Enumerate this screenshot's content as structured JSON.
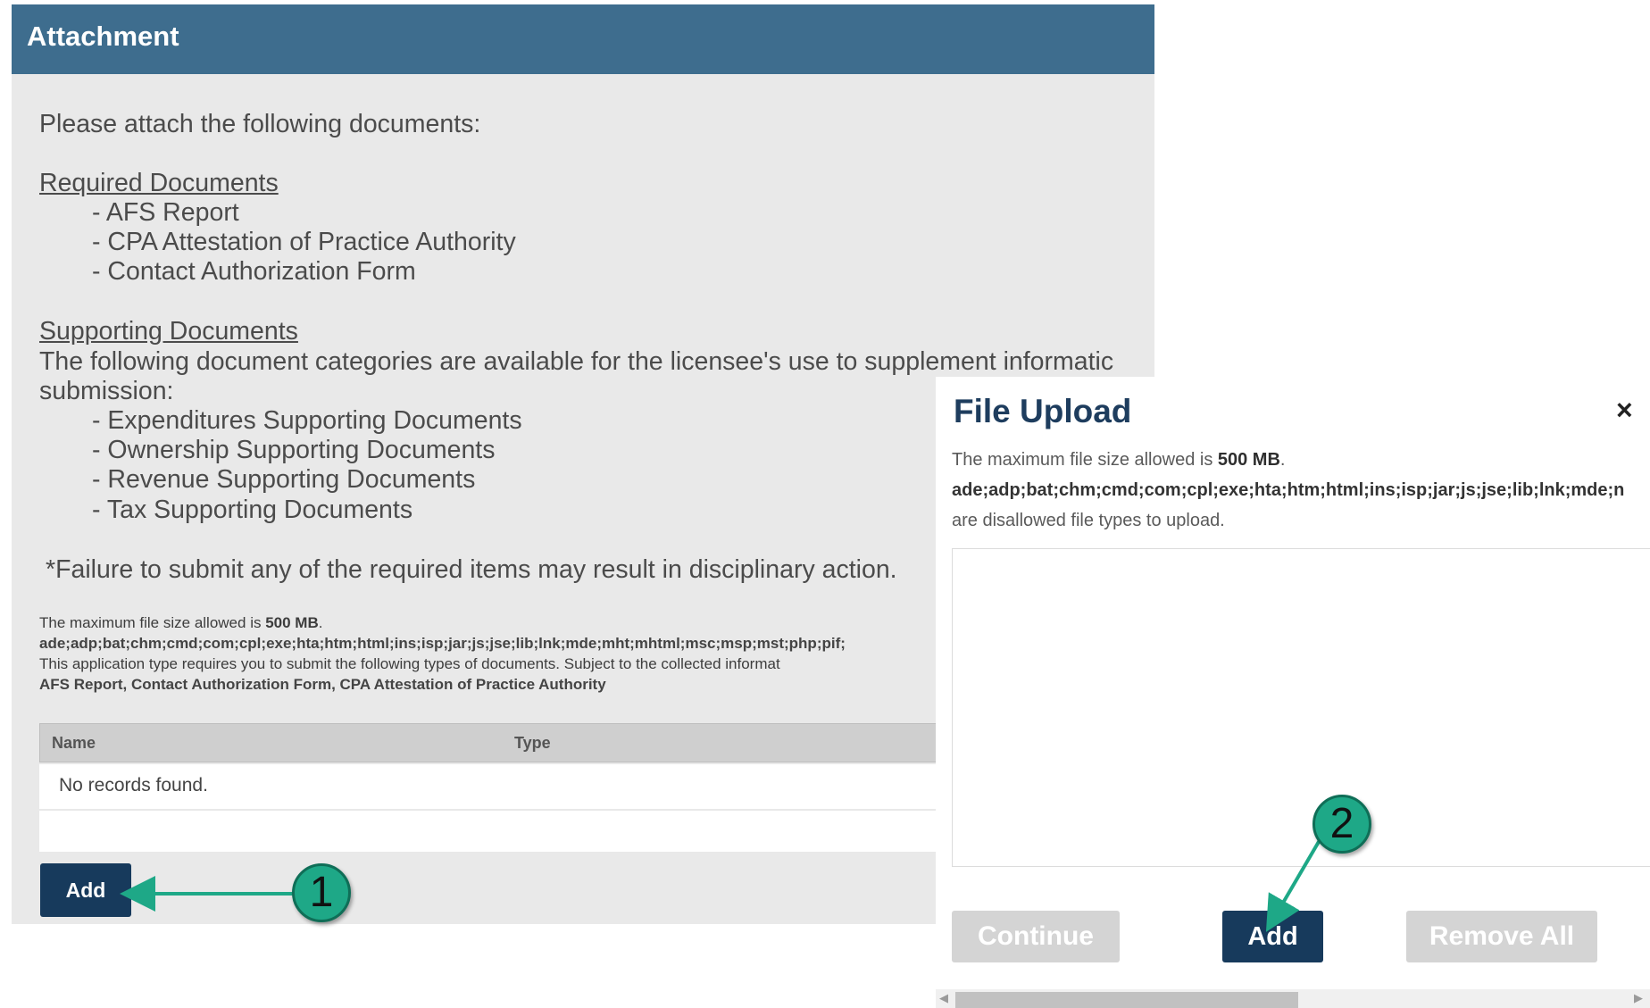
{
  "attachment": {
    "title": "Attachment",
    "intro": "Please attach the following documents:",
    "required_title": "Required Documents",
    "required_items": [
      "- AFS Report",
      "- CPA Attestation of Practice Authority",
      "- Contact Authorization Form"
    ],
    "supporting_title": "Supporting Documents",
    "supporting_desc_line1": "The following document categories are available for the licensee's use to supplement informatic",
    "supporting_desc_line2": "submission:",
    "supporting_items": [
      "- Expenditures Supporting Documents",
      "- Ownership Supporting Documents",
      "- Revenue Supporting Documents",
      "- Tax Supporting Documents"
    ],
    "warning": "*Failure to submit any of the required items may result in disciplinary action.",
    "max_size_prefix": "The maximum file size allowed is ",
    "max_size_value": "500 MB",
    "max_size_suffix": ".",
    "disallowed_types": "ade;adp;bat;chm;cmd;com;cpl;exe;hta;htm;html;ins;isp;jar;js;jse;lib;lnk;mde;mht;mhtml;msc;msp;mst;php;pif;",
    "requirement_note": "This application type requires you to submit the following types of documents. Subject to the collected informat",
    "required_list": "AFS Report, Contact Authorization Form, CPA Attestation of Practice Authority",
    "table": {
      "columns": [
        "Name",
        "Type"
      ],
      "empty_text": "No records found."
    },
    "add_label": "Add"
  },
  "dialog": {
    "title": "File Upload",
    "close_glyph": "×",
    "max_size_prefix": "The maximum file size allowed is ",
    "max_size_value": "500 MB",
    "max_size_suffix": ".",
    "disallowed_types": "ade;adp;bat;chm;cmd;com;cpl;exe;hta;htm;html;ins;isp;jar;js;jse;lib;lnk;mde;n",
    "disallowed_note": "are disallowed file types to upload.",
    "continue_label": "Continue",
    "add_label": "Add",
    "remove_all_label": "Remove All"
  },
  "callouts": {
    "step1": "1",
    "step2": "2",
    "color": "#1ea887"
  },
  "colors": {
    "header": "#3e6d8e",
    "primary_button": "#173a5c",
    "disabled_button": "#d4d4d4"
  }
}
